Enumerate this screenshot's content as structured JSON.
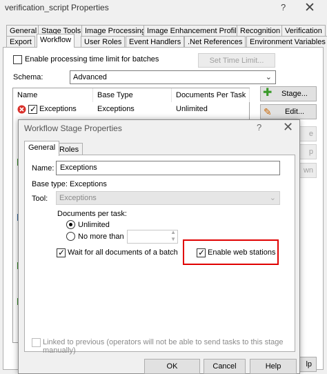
{
  "window": {
    "title": "verification_script Properties",
    "help": "?",
    "close": "✕"
  },
  "tabs_row1": [
    "General",
    "Stage Tools",
    "Image Processing",
    "Image Enhancement Profiles",
    "Recognition",
    "Verification"
  ],
  "tabs_row2": [
    "Export",
    "Workflow",
    "User Roles",
    "Event Handlers",
    ".Net References",
    "Environment Variables"
  ],
  "batch_limit": {
    "label": "Enable processing time limit for batches",
    "button": "Set Time Limit..."
  },
  "schema": {
    "label": "Schema:",
    "value": "Advanced"
  },
  "stage_list": {
    "columns": [
      "Name",
      "Base Type",
      "Documents Per Task"
    ],
    "row": {
      "name": "Exceptions",
      "base_type": "Exceptions",
      "docs": "Unlimited"
    }
  },
  "side_buttons": {
    "stage": "Stage...",
    "edit": "Edit...",
    "partial3": "e",
    "partial4": "p",
    "partial5": "wn"
  },
  "dialog": {
    "title": "Workflow Stage Properties",
    "help": "?",
    "close": "✕",
    "tabs": [
      "General",
      "Roles"
    ],
    "name_label": "Name:",
    "name_value": "Exceptions",
    "base_type": "Base type: Exceptions",
    "tool_label": "Tool:",
    "tool_value": "Exceptions",
    "docs_label": "Documents per task:",
    "unlimited": "Unlimited",
    "no_more_than": "No more than",
    "wait_all": "Wait for all documents of a batch",
    "web_stations": "Enable web stations",
    "linked": "Linked to previous (operators will not be able to send tasks to this stage manually)",
    "ok": "OK",
    "cancel": "Cancel",
    "help_btn": "Help",
    "outer_help_partial": "lp"
  }
}
